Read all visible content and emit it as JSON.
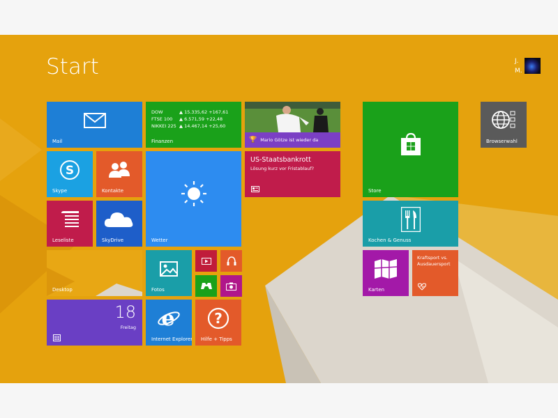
{
  "screen": {
    "title": "Start",
    "user": {
      "first": "J.",
      "last": "M."
    }
  },
  "tiles": {
    "mail": {
      "label": "Mail",
      "color": "#1e7fd6"
    },
    "finance": {
      "label": "Finanzen",
      "color": "#1aa11a",
      "rows": [
        {
          "index": "DOW",
          "value": "▲ 15.335,62 +167,61"
        },
        {
          "index": "FTSE 100",
          "value": "▲ 6.571,59 +22,48"
        },
        {
          "index": "NIKKEI 225",
          "value": "▲ 14.467,14 +25,60"
        }
      ]
    },
    "sports_news": {
      "caption": "Mario Götze ist wieder da",
      "color": "#7b3fc4"
    },
    "news": {
      "headline": "US-Staatsbankrott",
      "sub": "Lösung kurz vor Fristablauf?",
      "color": "#c01c4b"
    },
    "store": {
      "label": "Store",
      "color": "#1aa11a"
    },
    "browser_choice": {
      "label": "Browserwahl",
      "color": "#5a5a5a"
    },
    "skype": {
      "label": "Skype",
      "color": "#1ba1e2"
    },
    "contacts": {
      "label": "Kontakte",
      "color": "#e35a2a"
    },
    "weather": {
      "label": "Wetter",
      "color": "#2d8cf0"
    },
    "reading_list": {
      "label": "Leseliste",
      "color": "#c01c4b"
    },
    "skydrive": {
      "label": "SkyDrive",
      "color": "#1e5ec9"
    },
    "desktop": {
      "label": "Desktop"
    },
    "photos": {
      "label": "Fotos",
      "color": "#1a9ea8"
    },
    "video": {
      "color": "#c01c3a"
    },
    "music": {
      "color": "#e35a2a"
    },
    "games": {
      "color": "#1aa11a"
    },
    "camera": {
      "color": "#b0168a"
    },
    "calendar": {
      "day": "18",
      "weekday": "Freitag",
      "color": "#6a3fc4"
    },
    "ie": {
      "label": "Internet Explorer",
      "color": "#1e7fd6"
    },
    "help": {
      "label": "Hilfe + Tipps",
      "color": "#e35a2a"
    },
    "food": {
      "label": "Kochen & Genuss",
      "color": "#1a9ea8"
    },
    "maps": {
      "label": "Karten",
      "color": "#a319a8"
    },
    "health": {
      "label": "Kraftsport vs. Ausdauersport",
      "color": "#e35a2a"
    }
  }
}
